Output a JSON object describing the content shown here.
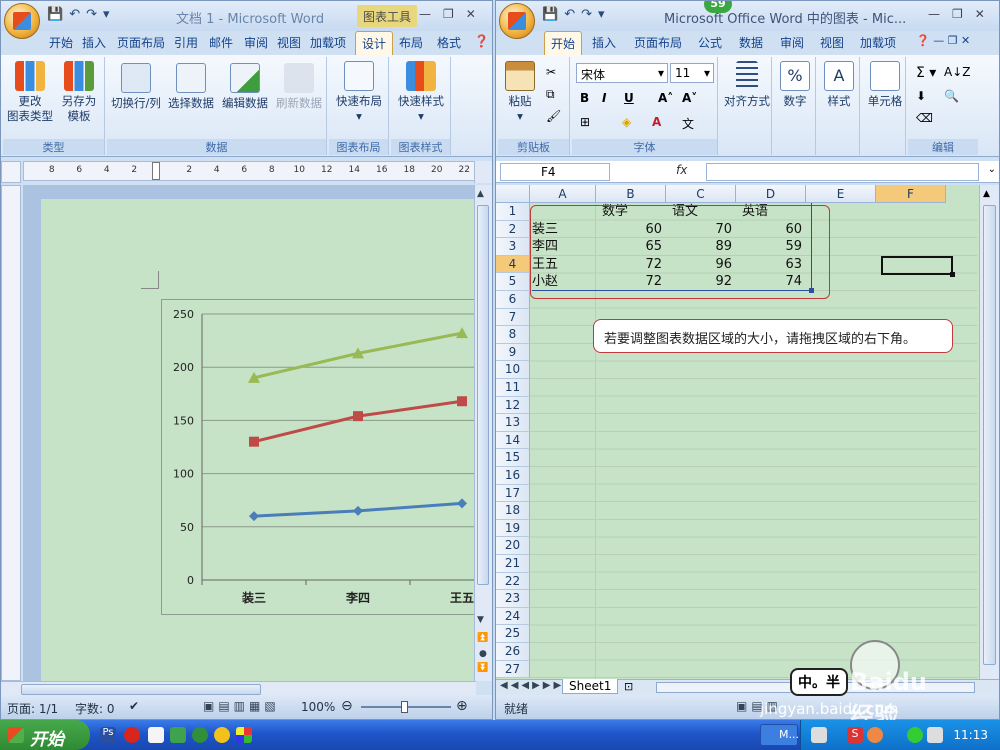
{
  "word": {
    "title": "文档 1 - Microsoft Word",
    "context_tab": "图表工具",
    "tabs": [
      "开始",
      "插入",
      "页面布局",
      "引用",
      "邮件",
      "审阅",
      "视图",
      "加载项",
      "设计",
      "布局",
      "格式"
    ],
    "active_tab": "设计",
    "ribbon": {
      "groups": [
        {
          "label": "类型",
          "buttons": [
            "更改\n图表类型",
            "另存为\n模板"
          ]
        },
        {
          "label": "数据",
          "buttons": [
            "切换行/列",
            "选择数据",
            "编辑数据",
            "刷新数据"
          ]
        },
        {
          "label": "图表布局",
          "buttons": [
            "快速布局"
          ]
        },
        {
          "label": "图表样式",
          "buttons": [
            "快速样式"
          ]
        }
      ]
    },
    "ruler_numbers": [
      "8",
      "6",
      "4",
      "2",
      "",
      "2",
      "4",
      "6",
      "8",
      "10",
      "12",
      "14",
      "16",
      "18",
      "20",
      "22"
    ],
    "status": {
      "page": "页面: 1/1",
      "words": "字数: 0",
      "zoom": "100%"
    }
  },
  "chart_data": {
    "type": "line",
    "categories": [
      "装三",
      "李四",
      "王五"
    ],
    "series": [
      {
        "values": [
          60,
          65,
          72
        ],
        "color": "#4a7ebb",
        "marker": "diamond"
      },
      {
        "values": [
          130,
          154,
          168
        ],
        "color": "#be4b48",
        "marker": "square"
      },
      {
        "values": [
          190,
          213,
          232
        ],
        "color": "#98b954",
        "marker": "triangle"
      }
    ],
    "ylim": [
      0,
      250
    ],
    "yticks": [
      "0",
      "50",
      "100",
      "150",
      "200",
      "250"
    ],
    "grid": true
  },
  "excel": {
    "title": "Microsoft Office Word 中的图表 - Mic...",
    "badge": "59",
    "tabs": [
      "开始",
      "插入",
      "页面布局",
      "公式",
      "数据",
      "审阅",
      "视图",
      "加载项"
    ],
    "active_tab": "开始",
    "font_name": "宋体",
    "font_size": "11",
    "ribbon_labels": {
      "paste": "粘贴",
      "align": "对齐方式",
      "number": "数字",
      "styles": "样式",
      "cells": "单元格"
    },
    "group_labels": [
      "剪贴板",
      "字体",
      "编辑"
    ],
    "name_box": "F4",
    "fx": "fx",
    "columns": [
      "A",
      "B",
      "C",
      "D",
      "E",
      "F"
    ],
    "rows": [
      "1",
      "2",
      "3",
      "4",
      "5",
      "6",
      "7",
      "8",
      "9",
      "10",
      "11",
      "12",
      "13",
      "14",
      "15",
      "16",
      "17",
      "18",
      "19",
      "20",
      "21",
      "22",
      "23",
      "24",
      "25",
      "26",
      "27"
    ],
    "table": {
      "headers": [
        "数学",
        "语文",
        "英语"
      ],
      "rows": [
        {
          "name": "装三",
          "vals": [
            "60",
            "70",
            "60"
          ]
        },
        {
          "name": "李四",
          "vals": [
            "65",
            "89",
            "59"
          ]
        },
        {
          "name": "王五",
          "vals": [
            "72",
            "96",
            "63"
          ]
        },
        {
          "name": "小赵",
          "vals": [
            "72",
            "92",
            "74"
          ]
        }
      ]
    },
    "callout": "若要调整图表数据区域的大小，请拖拽区域的右下角。",
    "sheet_tab": "Sheet1",
    "status": "就绪"
  },
  "taskbar": {
    "start": "开始",
    "clock": "11:13",
    "task_label": "M..."
  },
  "watermark": {
    "text": "Baidu经验",
    "url": "jingyan.baidu.com",
    "ime": "中。半"
  }
}
